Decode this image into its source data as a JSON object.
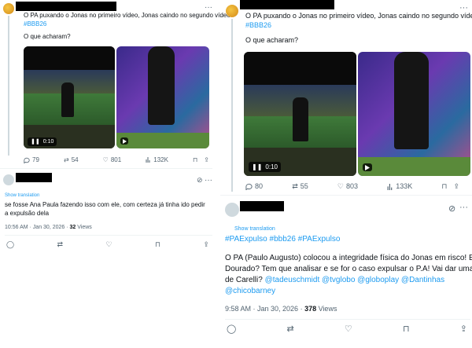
{
  "left": {
    "tweet": {
      "line1": "O PA puxando o Jonas no primeiro vídeo, Jonas caindo no segundo vídeo",
      "hashtag": "#BBB26",
      "question": "O que acharam?",
      "video1_time": "0:10",
      "metrics": {
        "replies": "79",
        "reposts": "54",
        "likes": "801",
        "views": "132K"
      }
    },
    "reply": {
      "show_translation": "Show translation",
      "text_line1": "se fosse Ana Paula fazendo isso com ele, com certeza já tinha ido pedir",
      "text_line2": "a expulsão dela",
      "timestamp": "10:56 AM · Jan 30, 2026 · ",
      "views_count": "32",
      "views_label": " Views"
    }
  },
  "right": {
    "tweet": {
      "line1": "O PA puxando o Jonas no primeiro vídeo, Jonas caindo no segundo vídeo",
      "hashtag": "#BBB26",
      "question": "O que acharam?",
      "video1_time": "0:10",
      "metrics": {
        "replies": "80",
        "reposts": "55",
        "likes": "803",
        "views": "133K"
      }
    },
    "reply": {
      "show_translation": "Show translation",
      "hashtags_line": "#PAExpulso #bbb26 #PAExpulso",
      "body_line1": "O PA (Paulo Augusto) colocou a integridade física do Jonas em risco! E aí",
      "body_line2": "Dourado? Tem que analisar e se for o caso expulsar o P.A! Vai dar uma",
      "body_line3_plain": "de Carelli? ",
      "body_line3_mentions": "@tadeuschmidt @tvglobo @globoplay @Dantinhas",
      "body_line4_mention": "@chicobarney",
      "timestamp": "9:58 AM · Jan 30, 2026 · ",
      "views_count": "378",
      "views_label": " Views"
    }
  },
  "colors": {
    "blue": "#1d9bf0",
    "muted": "#536471",
    "text": "#0f1419"
  }
}
